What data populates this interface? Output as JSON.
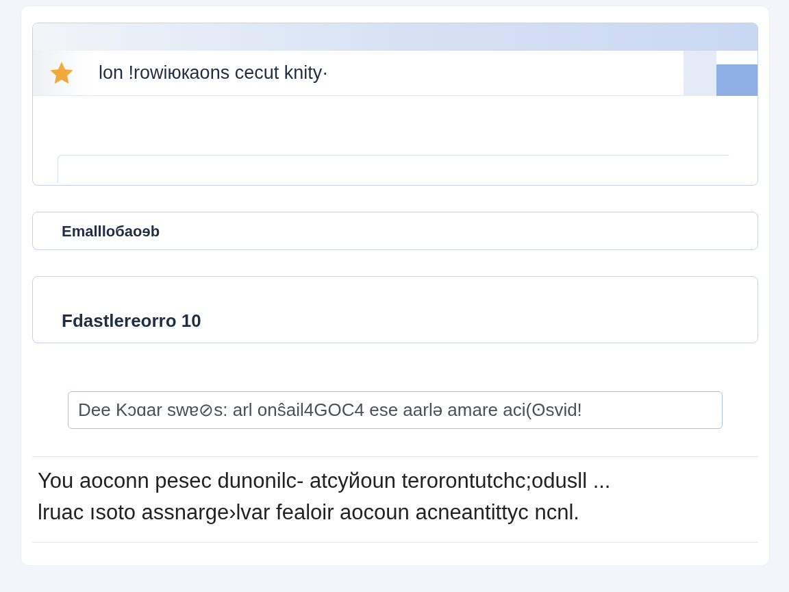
{
  "header": {
    "title": "lon !rowiюкaons cecut knity·"
  },
  "fields": [
    {
      "kind": "label",
      "text": "Emallloбaoɘb"
    },
    {
      "kind": "tall",
      "text": "Fdastlereorro 10"
    }
  ],
  "input": {
    "value": "Dee Kɔɑar swɐ⊘s: arl onŝail4GOC4 ese aarlə amare aci(ʘsvid!"
  },
  "message": [
    "You aoconn pesec dunonilc- atcyйoun terorontutchc;odusll ...",
    "lruac ısoto assnarge›lvar fealoir aocoun acneantittyc ncnl."
  ]
}
